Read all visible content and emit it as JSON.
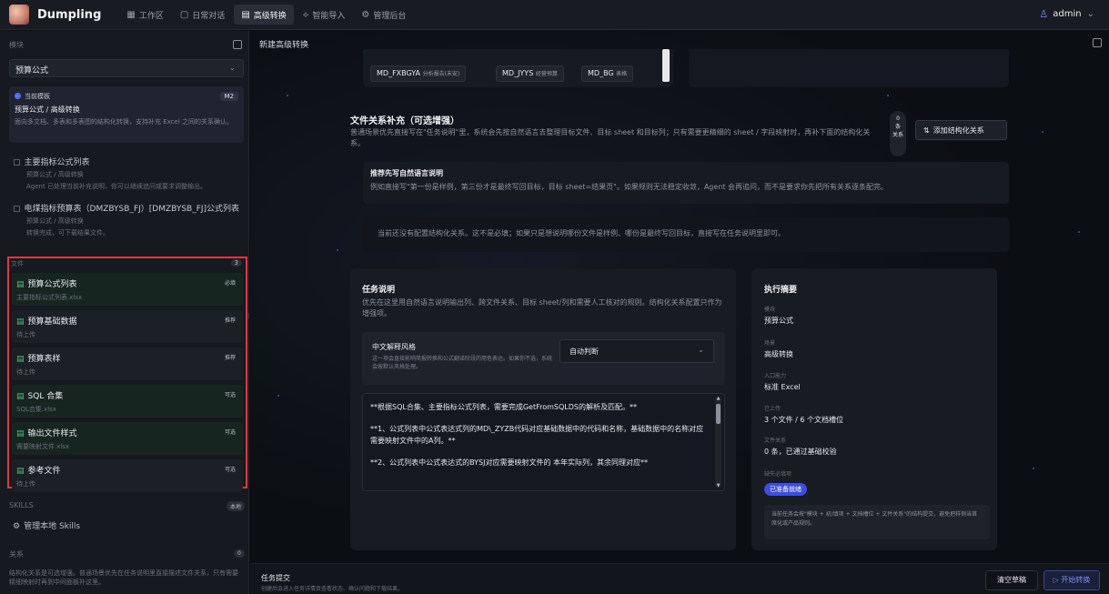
{
  "app": {
    "name": "Dumpling"
  },
  "nav": [
    {
      "icon": "▦",
      "label": "工作区"
    },
    {
      "icon": "▢",
      "label": "日常对话"
    },
    {
      "icon": "▤",
      "label": "高级转换"
    },
    {
      "icon": "⟡",
      "label": "智能导入"
    },
    {
      "icon": "⚙",
      "label": "管理后台"
    }
  ],
  "user": {
    "name": "admin"
  },
  "sidebar": {
    "module_label": "模块",
    "module_select": "预算公式",
    "template": {
      "label": "当前模板",
      "badge": "M2",
      "name": "预算公式 / 高级转换",
      "desc": "面向多文档、多表和多表图的结构化转换，支持补充 Excel 之间的关系确认。"
    },
    "history": [
      {
        "title": "主要指标公式列表",
        "path": "预算公式 / 高级转换",
        "note": "Agent 已处理当前补充说明，你可以继续追问或要求调整输出。"
      },
      {
        "title": "电煤指标预算表（DMZBYSB_FJ）[DMZBYSB_FJ]公式列表",
        "path": "预算公式 / 高级转换",
        "note": "转换完成，可下载结果文件。"
      }
    ],
    "files_label": "文件",
    "files_count": "3",
    "files": [
      {
        "name": "预算公式列表",
        "tag": "必填",
        "sub": "主要指标公式列表.xlsx",
        "uploaded": true
      },
      {
        "name": "预算基础数据",
        "tag": "推荐",
        "sub": "待上传",
        "uploaded": false
      },
      {
        "name": "预算表样",
        "tag": "推荐",
        "sub": "待上传",
        "uploaded": false
      },
      {
        "name": "SQL 合集",
        "tag": "可选",
        "sub": "SQL合集.xlsx",
        "uploaded": true
      },
      {
        "name": "输出文件样式",
        "tag": "可选",
        "sub": "需要映射文件.xlsx",
        "uploaded": true
      },
      {
        "name": "参考文件",
        "tag": "可选",
        "sub": "待上传",
        "uploaded": false
      }
    ],
    "skills_label": "SKILLS",
    "skills_badge": "本地",
    "skills_item": "管理本地 Skills",
    "relations_label": "关系",
    "relations_count": "0",
    "relations_desc": "结构化关系是可选增强。普通场景优先在任务说明里直接描述文件关系，只有需要精细映射时再到中间面板补这里。"
  },
  "main": {
    "title": "新建高级转换",
    "chips": [
      {
        "code": "MD_FXBGYA",
        "name": "分析报告(未安)"
      },
      {
        "code": "MD_JYYS",
        "name": "经营预算"
      },
      {
        "code": "MD_BG",
        "name": "表格"
      }
    ],
    "relation": {
      "title": "文件关系补充（可选增强）",
      "desc": "普通场景优先直接写在\"任务说明\"里，系统会先按自然语言去整理目标文件、目标 sheet 和目标列；只有需要更精细的 sheet / 字段映射时，再补下面的结构化关系。",
      "count_num": "0",
      "count_unit": "条",
      "count_word": "关系",
      "add_button": "添加结构化关系",
      "rec_title": "推荐先写自然语言说明",
      "rec_desc": "例如直接写\"第一份是样例，第三份才是最终写回目标，目标 sheet=结果页\"。如果规则无法稳定收敛，Agent 会再追问，而不是要求你先把所有关系逐条配完。",
      "empty": "当前还没有配置结构化关系。这不是必填；如果只是想说明哪份文件是样例、哪份是最终写回目标，直接写在任务说明里即可。"
    },
    "task": {
      "title": "任务说明",
      "desc": "优先在这里用自然语言说明输出列、跨文件关系、目标 sheet/列和需要人工核对的规则。结构化关系配置只作为增强项。",
      "style_title": "中文解释风格",
      "style_desc": "这一项会直接影响简报转换和公式翻译阶段的用色表达。如果你不选，系统会按默认风格处理。",
      "style_value": "自动判断",
      "text": [
        "**根据SQL合集、主要指标公式列表，需要完成GetFromSQLDS的解析及匹配。**",
        "**1、公式列表中公式表达式列的MD\\_ZYZB代码对应基础数据中的代码和名称，基础数据中的名称对应需要映射文件中的A列。**",
        "**2、公式列表中公式表达式的BYSJ对应需要映射文件的 本年实际列，其余同理对应**"
      ]
    },
    "exec": {
      "title": "执行摘要",
      "items": [
        {
          "label": "模块",
          "value": "预算公式"
        },
        {
          "label": "场景",
          "value": "高级转换"
        },
        {
          "label": "入口能力",
          "value": "标准 Excel"
        },
        {
          "label": "已上传",
          "value": "3 个文件 / 6 个文档槽位"
        },
        {
          "label": "文件关系",
          "value": "0 条，已通过基础校验"
        }
      ],
      "missing_label": "缺失必填项",
      "ready_badge": "已准备就绪",
      "note": "当前任务会按\"模块 + 初/填项 + 文档槽位 + 文件关系\"的结构提交，避免把样例当首席化或产品规则。"
    },
    "submit": {
      "title": "任务提交",
      "desc": "创建后会进入任务详情页查看状态、确认问题和下载结果。",
      "clear": "清空草稿",
      "start": "开始转换"
    }
  },
  "colors": {
    "accent": "#5b6cff",
    "highlight_border": "#e0393e",
    "success": "#4fc27a"
  }
}
